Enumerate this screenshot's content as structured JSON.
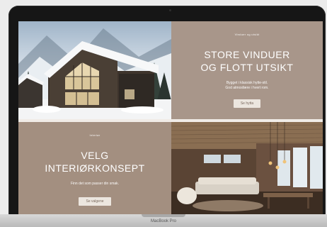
{
  "device": {
    "brand_label": "MacBook Pro"
  },
  "store_panel": {
    "eyebrow": "Vinduer og utsikt",
    "headline_line1": "STORE VINDUER",
    "headline_line2": "OG FLOTT UTSIKT",
    "body_line1": "Bygget i klassisk hytte-stil.",
    "body_line2": "God atmosfære i hvert rom.",
    "button_label": "Se hytta"
  },
  "velg_panel": {
    "eyebrow": "Interiør",
    "headline_line1": "VELG",
    "headline_line2": "INTERIØRKONSEPT",
    "body_line1": "Finn det som passer din smak.",
    "button_label": "Se valgene"
  },
  "colors": {
    "panel_taupe": "#a8968a",
    "panel_taupe_dark": "#a38f80",
    "button_bg": "#ece6df",
    "bezel": "#161616"
  },
  "images": {
    "cabin": "snowy-cabin-photo",
    "interior": "wood-interior-photo"
  }
}
